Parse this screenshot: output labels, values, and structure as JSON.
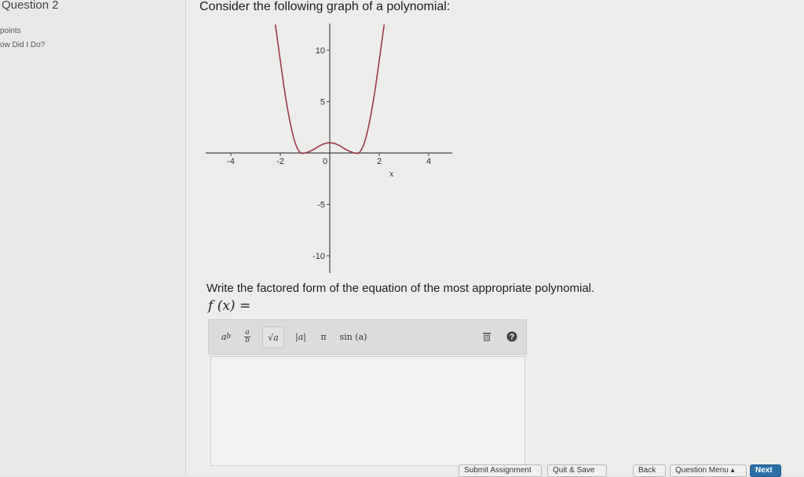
{
  "sidebar": {
    "question_title": "Question 2",
    "points_label": "points",
    "how_did_label": "ow Did I Do?"
  },
  "question": {
    "prompt": "Consider the following graph of a polynomial:",
    "instruction": "Write the factored form of the equation of the most appropriate polynomial.",
    "function_label": "f (x)",
    "equals": "="
  },
  "chart_data": {
    "type": "line",
    "title": "",
    "xlabel": "x",
    "ylabel": "",
    "xlim": [
      -4.9,
      4.9
    ],
    "ylim": [
      -12,
      12.5
    ],
    "x_ticks": [
      -4,
      -2,
      0,
      2,
      4
    ],
    "x_tick_labels": [
      "-4",
      "-2",
      "0",
      "2",
      "4"
    ],
    "y_ticks": [
      -10,
      -5,
      5,
      10
    ],
    "y_tick_labels": [
      "-10",
      "-5",
      "5",
      "10"
    ],
    "grid": false,
    "series": [
      {
        "x": [
          -2.2,
          -2.0,
          -1.8,
          -1.6,
          -1.4,
          -1.2,
          -1.0,
          -0.8,
          -0.6,
          -0.4,
          -0.2,
          0.0,
          0.2,
          0.4,
          0.6,
          0.8,
          1.0,
          1.2,
          1.4,
          1.6,
          1.8,
          2.0,
          2.2
        ],
        "y": [
          12.5,
          9.0,
          5.65,
          2.94,
          1.0,
          0.05,
          0.0,
          0.17,
          0.41,
          0.71,
          0.92,
          1.0,
          0.92,
          0.71,
          0.41,
          0.17,
          0.0,
          0.05,
          1.0,
          2.94,
          5.65,
          9.0,
          12.5
        ]
      }
    ],
    "color": "#9b3a4a"
  },
  "toolbar": {
    "power_label": "a",
    "power_sup": "b",
    "fraction_num": "a",
    "fraction_den": "b",
    "sqrt_label": "√a",
    "abs_label": "|a|",
    "pi_label": "π",
    "sin_label": "sin (a)",
    "trash_icon": "trash-icon",
    "help_icon": "help-icon"
  },
  "footer": {
    "submit": "Submit Assignment",
    "quit": "Quit & Save",
    "back": "Back",
    "menu": "Question Menu ▴",
    "next": "Next"
  }
}
